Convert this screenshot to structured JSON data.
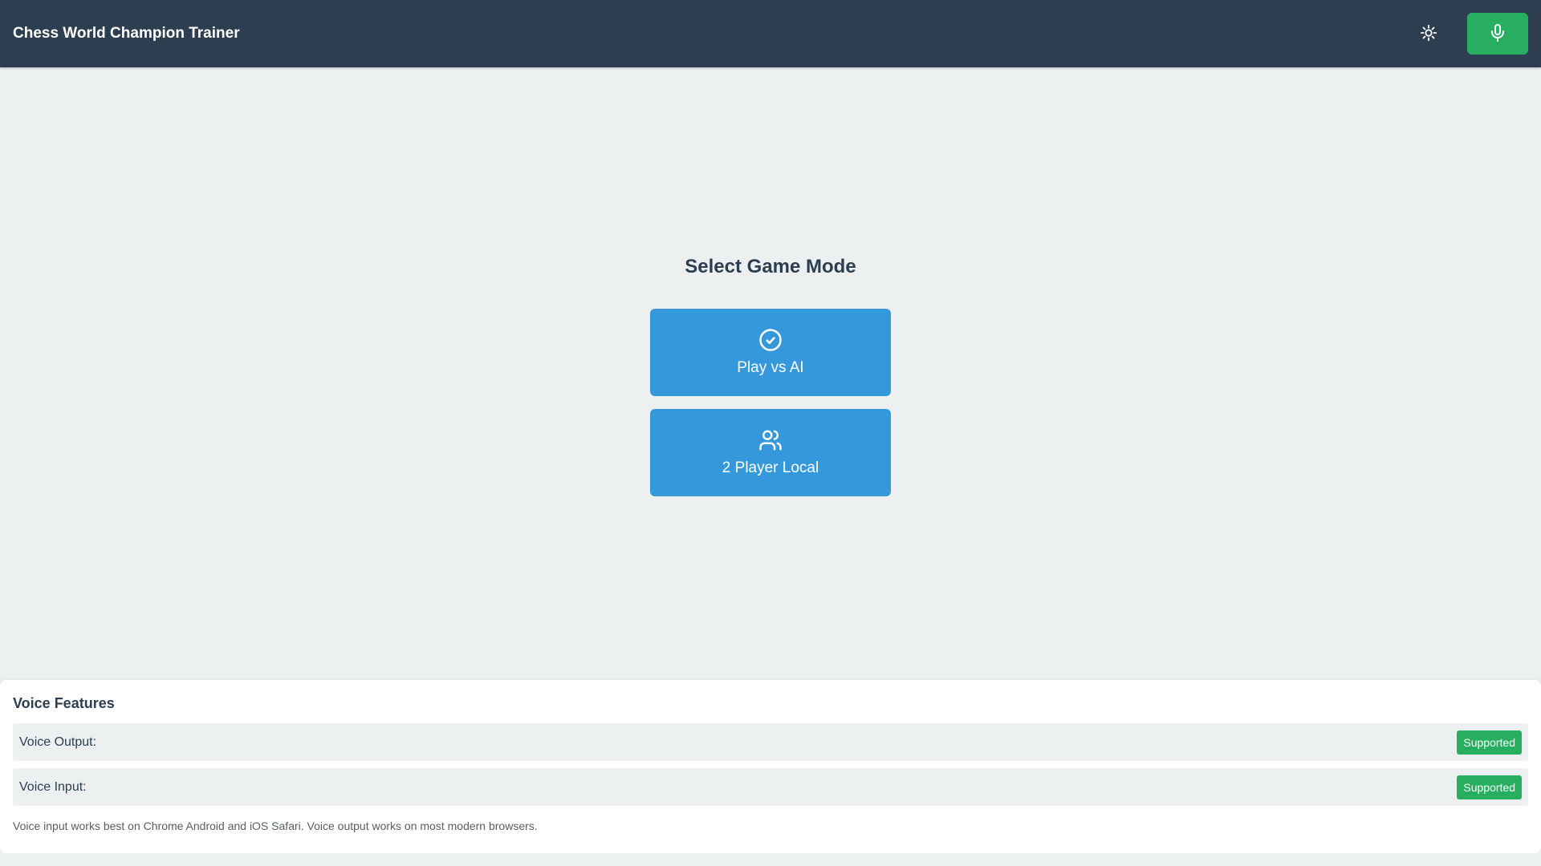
{
  "header": {
    "title": "Chess World Champion Trainer",
    "theme_icon": "sun-icon",
    "mic_icon": "microphone-icon",
    "mic_color": "#27ae60",
    "background": "#2c3e50"
  },
  "main": {
    "title": "Select Game Mode",
    "modes": [
      {
        "label": "Play vs AI",
        "icon": "check-circle-icon"
      },
      {
        "label": "2 Player Local",
        "icon": "users-icon"
      }
    ],
    "button_color": "#3498db"
  },
  "voice": {
    "title": "Voice Features",
    "rows": [
      {
        "label": "Voice Output:",
        "status": "Supported"
      },
      {
        "label": "Voice Input:",
        "status": "Supported"
      }
    ],
    "note": "Voice input works best on Chrome Android and iOS Safari. Voice output works on most modern browsers.",
    "badge_color": "#27ae60"
  }
}
